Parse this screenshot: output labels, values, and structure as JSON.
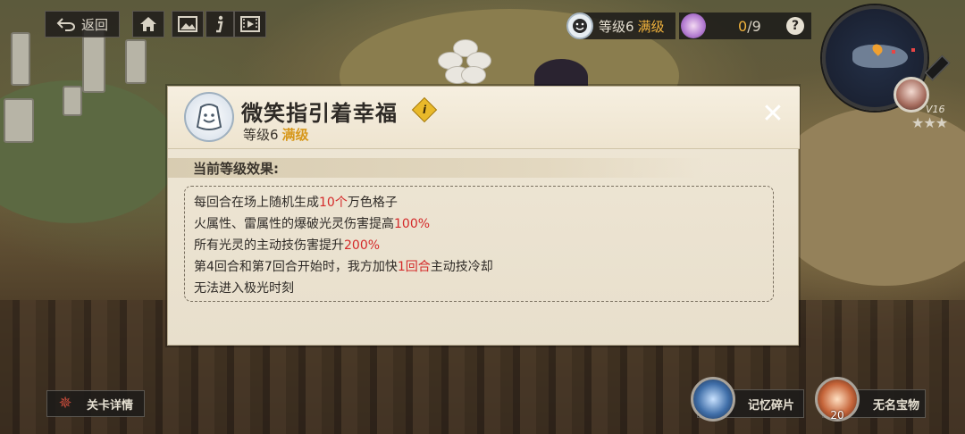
{
  "top_bar": {
    "back_label": "返回",
    "level_label": "等级6",
    "level_max": "满级",
    "fragments_current": "0",
    "fragments_total": "/9",
    "help_label": "?"
  },
  "minimap": {
    "level_tag": "V16",
    "stars": "★★★"
  },
  "dialog": {
    "title": "微笑指引着幸福",
    "info_badge": "i",
    "level_label": "等级6",
    "level_max": "满级",
    "close_label": "✕",
    "section_title": "当前等级效果:",
    "effects": [
      {
        "pre": "每回合在场上随机生成",
        "hl": "10个",
        "post": "万色格子"
      },
      {
        "pre": "火属性、雷属性的爆破光灵伤害提高",
        "hl": "100%",
        "post": ""
      },
      {
        "pre": "所有光灵的主动技伤害提升",
        "hl": "200%",
        "post": ""
      },
      {
        "pre": "第4回合和第7回合开始时，我方加快",
        "hl": "1回合",
        "post": "主动技冷却"
      },
      {
        "pre": "无法进入极光时刻",
        "hl": "",
        "post": ""
      }
    ]
  },
  "bottom": {
    "stage_details_label": "关卡详情",
    "memory_fragments_label": "记忆碎片",
    "nameless_treasure_label": "无名宝物",
    "treasure_count": "20"
  },
  "colors": {
    "highlight_red": "#d42a2a",
    "max_level_gold": "#f0b23c",
    "dialog_bg": "#efe7d6"
  }
}
